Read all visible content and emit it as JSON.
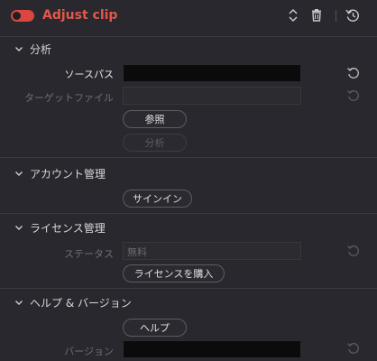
{
  "header": {
    "title": "Adjust clip",
    "enabled": true,
    "icons": [
      "updown-chevron-icon",
      "trash-icon",
      "reset-all-icon"
    ]
  },
  "analysis": {
    "title": "分析",
    "source_path_label": "ソースパス",
    "source_path_value": "",
    "target_file_label": "ターゲットファイル",
    "target_file_value": "",
    "browse_button": "参照",
    "analyze_button": "分析"
  },
  "account": {
    "title": "アカウント管理",
    "signin_button": "サインイン"
  },
  "license": {
    "title": "ライセンス管理",
    "status_label": "ステータス",
    "status_value": "無料",
    "buy_button": "ライセンスを購入"
  },
  "help": {
    "title": "ヘルプ & バージョン",
    "help_button": "ヘルプ",
    "version_label": "バージョン",
    "version_value": ""
  },
  "colors": {
    "accent": "#e2574c",
    "background": "#28282e"
  }
}
